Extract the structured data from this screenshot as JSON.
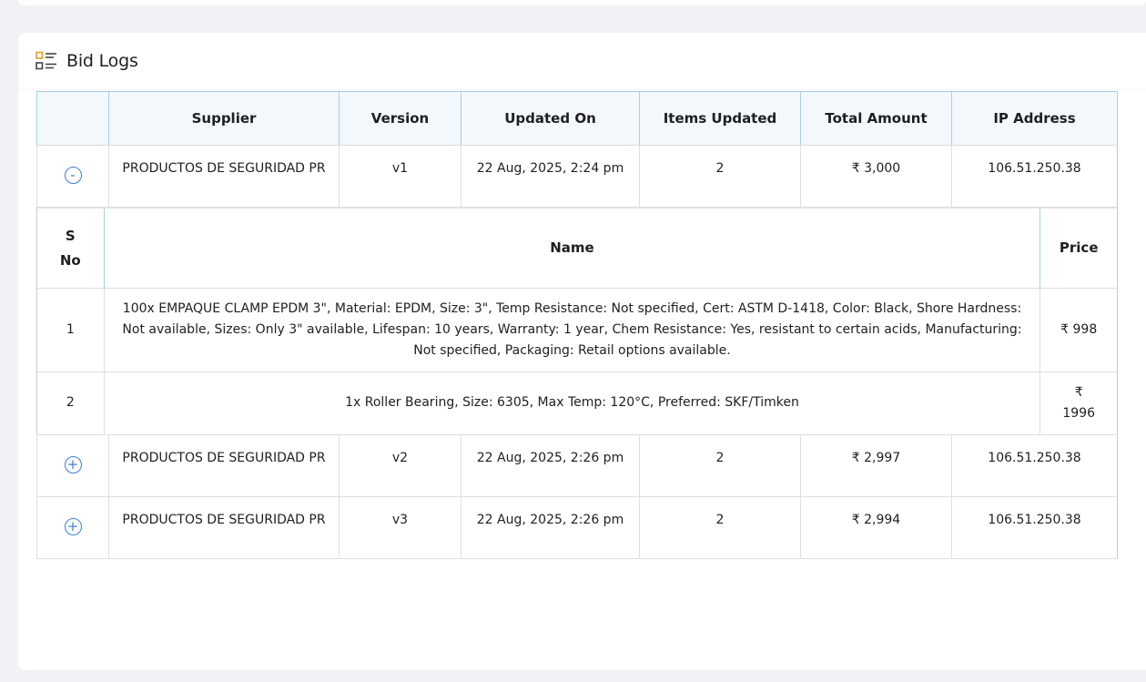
{
  "card": {
    "title": "Bid Logs",
    "icon": "list-icon"
  },
  "logs": {
    "columns": [
      "",
      "Supplier",
      "Version",
      "Updated On",
      "Items Updated",
      "Total Amount",
      "IP Address"
    ],
    "rows": [
      {
        "toggle": "-",
        "supplier": "PRODUCTOS DE SEGURIDAD PR",
        "version": "v1",
        "updated_on": "22 Aug, 2025, 2:24 pm",
        "items_updated": "2",
        "total_amount": "₹ 3,000",
        "ip": "106.51.250.38",
        "expanded": true
      },
      {
        "toggle": "+",
        "supplier": "PRODUCTOS DE SEGURIDAD PR",
        "version": "v2",
        "updated_on": "22 Aug, 2025, 2:26 pm",
        "items_updated": "2",
        "total_amount": "₹ 2,997",
        "ip": "106.51.250.38",
        "expanded": false
      },
      {
        "toggle": "+",
        "supplier": "PRODUCTOS DE SEGURIDAD PR",
        "version": "v3",
        "updated_on": "22 Aug, 2025, 2:26 pm",
        "items_updated": "2",
        "total_amount": "₹ 2,994",
        "ip": "106.51.250.38",
        "expanded": false
      }
    ]
  },
  "items": {
    "columns": [
      "S No",
      "Name",
      "Price"
    ],
    "rows": [
      {
        "sno": "1",
        "name": "100x EMPAQUE CLAMP EPDM 3\", Material: EPDM, Size: 3\", Temp Resistance: Not specified, Cert: ASTM D-1418, Color: Black, Shore Hardness: Not available, Sizes: Only 3\" available, Lifespan: 10 years, Warranty: 1 year, Chem Resistance: Yes, resistant to certain acids, Manufacturing: Not specified, Packaging: Retail options available.",
        "price": "₹ 998"
      },
      {
        "sno": "2",
        "name": "1x Roller Bearing, Size: 6305, Max Temp: 120°C, Preferred: SKF/Timken",
        "price": "₹ 1996"
      }
    ]
  },
  "colors": {
    "accent": "#3b7fd4",
    "header_bg": "#f3f8fd",
    "page_bg": "#f1f2f6"
  }
}
